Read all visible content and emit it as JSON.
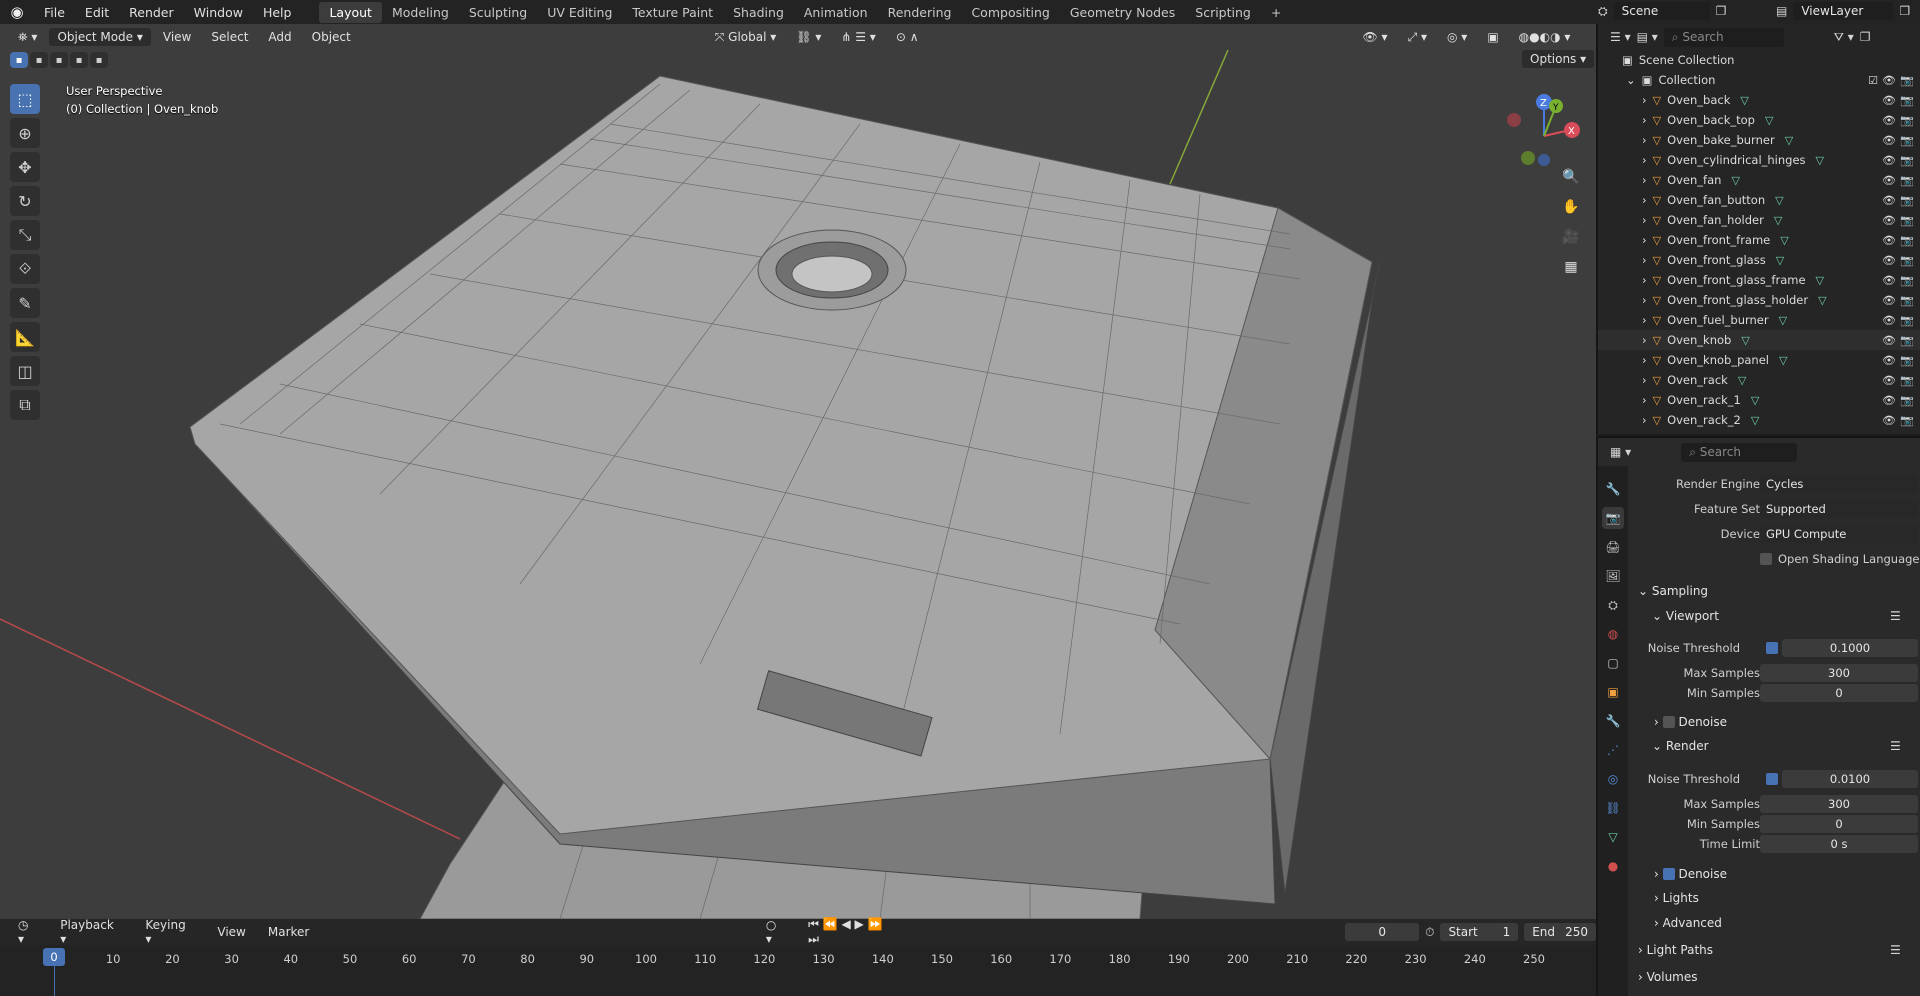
{
  "topbar": {
    "menus": [
      "File",
      "Edit",
      "Render",
      "Window",
      "Help"
    ],
    "workspaces": [
      "Layout",
      "Modeling",
      "Sculpting",
      "UV Editing",
      "Texture Paint",
      "Shading",
      "Animation",
      "Rendering",
      "Compositing",
      "Geometry Nodes",
      "Scripting"
    ],
    "active_workspace": "Layout",
    "add_tab": "+",
    "scene": "Scene",
    "view_layer": "ViewLayer"
  },
  "viewport": {
    "mode": "Object Mode",
    "menus": [
      "View",
      "Select",
      "Add",
      "Object"
    ],
    "orientation": "Global",
    "options": "Options",
    "perspective": "User Perspective",
    "collection_info": "(0) Collection | Oven_knob",
    "gizmo": {
      "z": "Z",
      "y": "Y",
      "x": "X"
    }
  },
  "timeline": {
    "menus": [
      "Playback",
      "Keying",
      "View",
      "Marker"
    ],
    "current_frame": "0",
    "start_label": "Start",
    "start": "1",
    "end_label": "End",
    "end": "250",
    "ticks": [
      "0",
      "10",
      "20",
      "30",
      "40",
      "50",
      "60",
      "70",
      "80",
      "90",
      "100",
      "110",
      "120",
      "130",
      "140",
      "150",
      "160",
      "170",
      "180",
      "190",
      "200",
      "210",
      "220",
      "230",
      "240",
      "250"
    ]
  },
  "outliner": {
    "search_placeholder": "Search",
    "scene_collection": "Scene Collection",
    "collection": "Collection",
    "items": [
      "Oven_back",
      "Oven_back_top",
      "Oven_bake_burner",
      "Oven_cylindrical_hinges",
      "Oven_fan",
      "Oven_fan_button",
      "Oven_fan_holder",
      "Oven_front_frame",
      "Oven_front_glass",
      "Oven_front_glass_frame",
      "Oven_front_glass_holder",
      "Oven_fuel_burner",
      "Oven_knob",
      "Oven_knob_panel",
      "Oven_rack",
      "Oven_rack_1",
      "Oven_rack_2"
    ],
    "selected": "Oven_knob"
  },
  "properties": {
    "search_placeholder": "Search",
    "render_engine_label": "Render Engine",
    "render_engine": "Cycles",
    "feature_set_label": "Feature Set",
    "feature_set": "Supported",
    "device_label": "Device",
    "device": "GPU Compute",
    "osl_label": "Open Shading Language",
    "sampling": "Sampling",
    "viewport": "Viewport",
    "noise_threshold_label": "Noise Threshold",
    "vp_noise_threshold": "0.1000",
    "max_samples_label": "Max Samples",
    "vp_max_samples": "300",
    "min_samples_label": "Min Samples",
    "vp_min_samples": "0",
    "denoise_label": "Denoise",
    "render": "Render",
    "r_noise_threshold": "0.0100",
    "r_max_samples": "300",
    "r_min_samples": "0",
    "time_limit_label": "Time Limit",
    "r_time_limit": "0 s",
    "lights": "Lights",
    "advanced": "Advanced",
    "light_paths": "Light Paths",
    "volumes": "Volumes"
  }
}
